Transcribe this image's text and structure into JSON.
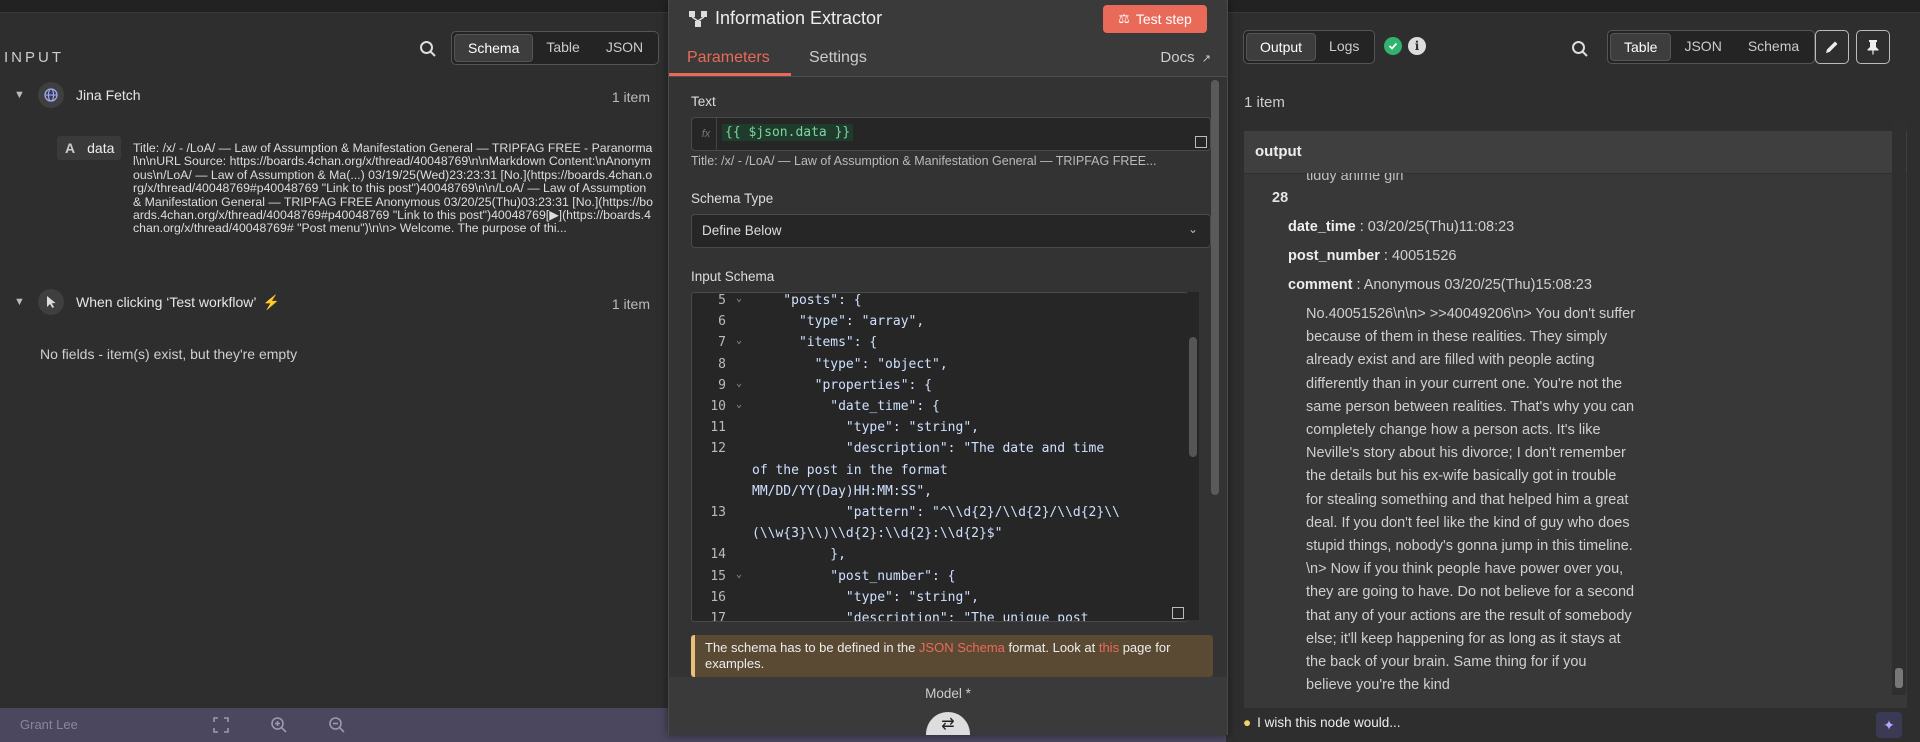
{
  "input": {
    "title": "INPUT",
    "tabs": [
      "Schema",
      "Table",
      "JSON"
    ],
    "nodes": [
      {
        "name": "Jina Fetch",
        "count": "1 item"
      },
      {
        "name": "When clicking ‘Test workflow’",
        "count": "1 item"
      }
    ],
    "field_type": "A",
    "field_name": "data",
    "field_value": "Title: /x/ - /LoA/ — Law of Assumption & Manifestation General — TRIPFAG FREE - Paranormal\\n\\nURL Source: https://boards.4chan.org/x/thread/40048769\\n\\nMarkdown Content:\\nAnonymous\\n/LoA/ — Law of Assumption & Ma(...) 03/19/25(Wed)23:23:31 [No.](https://boards.4chan.org/x/thread/40048769#p40048769 \"Link to this post\")40048769\\n\\n/LoA/ — Law of Assumption & Manifestation General — TRIPFAG FREE Anonymous 03/20/25(Thu)03:23:31 [No.](https://boards.4chan.org/x/thread/40048769#p40048769 \"Link to this post\")40048769[▶](https://boards.4chan.org/x/thread/40048769# \"Post menu\")\\n\\n> Welcome. The purpose of thi...",
    "no_fields": "No fields - item(s) exist, but they're empty"
  },
  "center": {
    "title": "Information Extractor",
    "test_step": "Test step",
    "tabs": [
      "Parameters",
      "Settings"
    ],
    "docs": "Docs",
    "text_label": "Text",
    "fx": "fx",
    "expression": "{{ $json.data }}",
    "preview": "Title: /x/ - /LoA/ — Law of Assumption & Manifestation General — TRIPFAG FREE...",
    "schema_type_label": "Schema Type",
    "schema_type_value": "Define Below",
    "input_schema_label": "Input Schema",
    "code_lines": [
      {
        "n": "5",
        "fold": true,
        "t": "    \"posts\": {"
      },
      {
        "n": "6",
        "fold": false,
        "t": "      \"type\": \"array\","
      },
      {
        "n": "7",
        "fold": true,
        "t": "      \"items\": {"
      },
      {
        "n": "8",
        "fold": false,
        "t": "        \"type\": \"object\","
      },
      {
        "n": "9",
        "fold": true,
        "t": "        \"properties\": {"
      },
      {
        "n": "10",
        "fold": true,
        "t": "          \"date_time\": {"
      },
      {
        "n": "11",
        "fold": false,
        "t": "            \"type\": \"string\","
      },
      {
        "n": "12",
        "fold": false,
        "t": "            \"description\": \"The date and time"
      },
      {
        "n": "",
        "fold": false,
        "t": "of the post in the format"
      },
      {
        "n": "",
        "fold": false,
        "t": "MM/DD/YY(Day)HH:MM:SS\","
      },
      {
        "n": "13",
        "fold": false,
        "t": "            \"pattern\": \"^\\\\d{2}/\\\\d{2}/\\\\d{2}\\\\"
      },
      {
        "n": "",
        "fold": false,
        "t": "(\\\\w{3}\\\\)\\\\d{2}:\\\\d{2}:\\\\d{2}$\""
      },
      {
        "n": "14",
        "fold": false,
        "t": "          },"
      },
      {
        "n": "15",
        "fold": true,
        "t": "          \"post_number\": {"
      },
      {
        "n": "16",
        "fold": false,
        "t": "            \"type\": \"string\","
      },
      {
        "n": "17",
        "fold": false,
        "t": "            \"description\": \"The unique post"
      }
    ],
    "warning_pre": "The schema has to be defined in the ",
    "warning_link": "JSON Schema",
    "warning_mid": " format. Look at ",
    "warning_link2": "this",
    "warning_post": " page for examples.",
    "model_label": "Model *"
  },
  "output": {
    "tabs_left": [
      "Output",
      "Logs"
    ],
    "tabs_right": [
      "Table",
      "JSON",
      "Schema"
    ],
    "count": "1 item",
    "column": "output",
    "cut_line": "tiddy anime girl",
    "index": "28",
    "date_time_key": "date_time",
    "date_time_val": "03/20/25(Thu)11:08:23",
    "post_number_key": "post_number",
    "post_number_val": "40051526",
    "comment_key": "comment",
    "comment_first": "Anonymous 03/20/25(Thu)15:08:23",
    "comment_body": "No.40051526\\n\\n> >>40049206\\n> You don't suffer because of them in these realities. They simply already exist and are filled with people acting differently than in your current one. You're not the same person between realities. That's why you can completely change how a person acts. It's like Neville's story about his divorce; I don't remember the details but his ex-wife basically got in trouble for stealing something and that helped him a great deal. If you don't feel like the kind of guy who does stupid things, nobody's gonna jump in this timeline. \\n> Now if you think people have power over you, they are going to have. Do not believe for a second that any of your actions are the result of somebody else; it'll keep happening for as long as it stays at the back of your brain. Same thing for if you believe you're the kind"
  },
  "bottom": {
    "user": "Grant Lee",
    "wish": "I wish this node would..."
  },
  "colors": {
    "accent": "#ea6a5a",
    "success": "#2fb36f",
    "warning_border": "#e8c07a"
  }
}
